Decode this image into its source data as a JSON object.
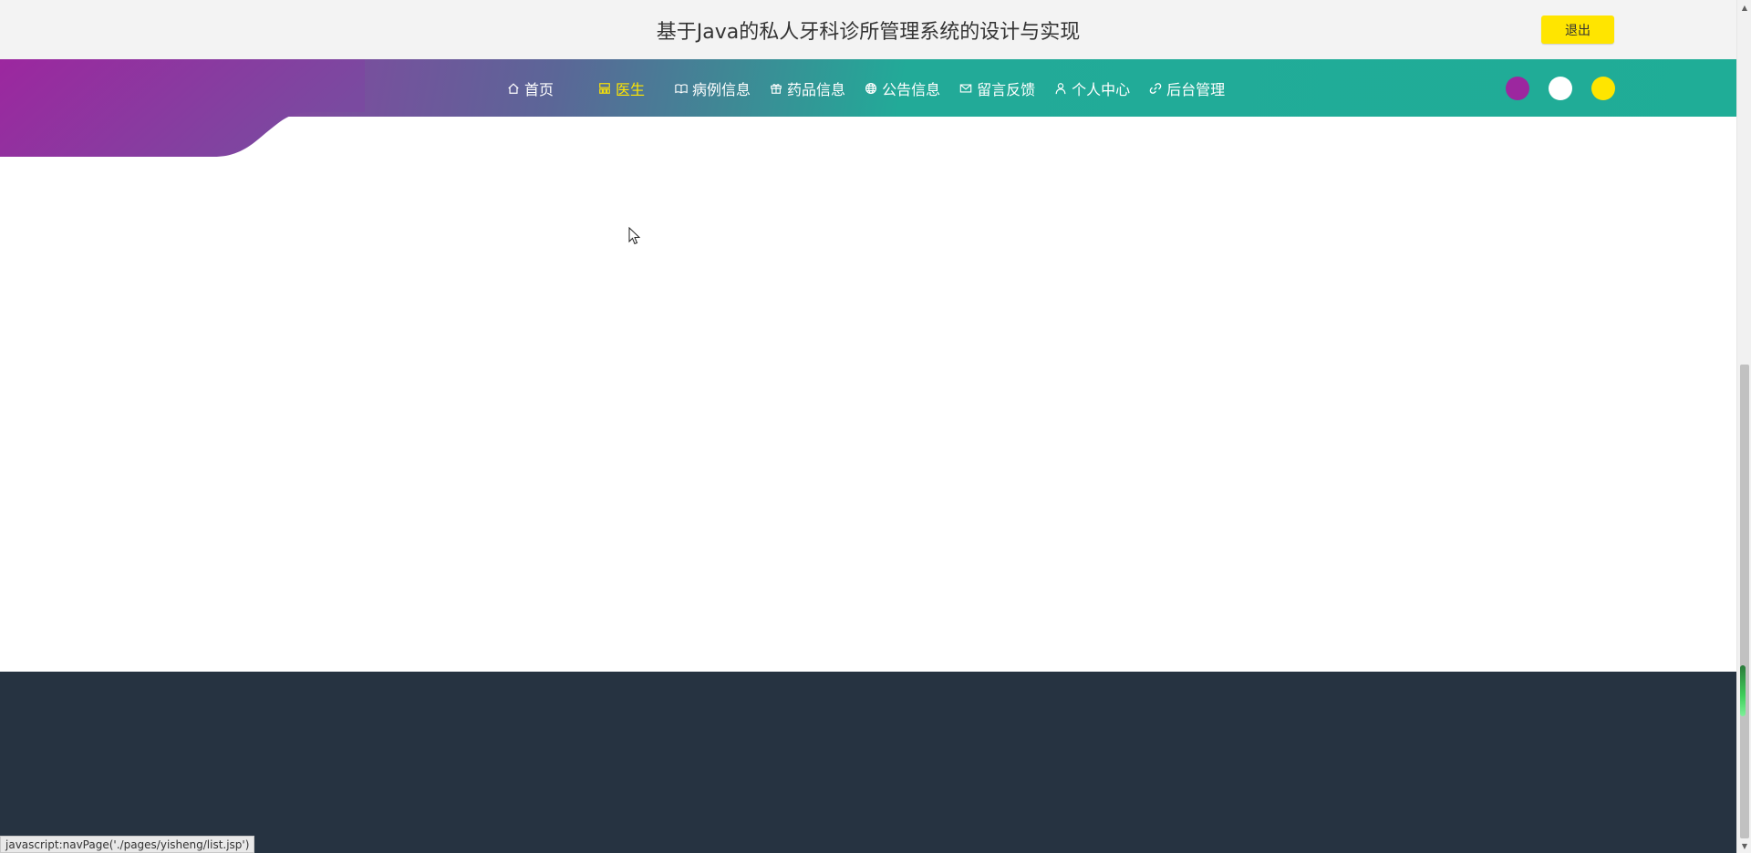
{
  "header": {
    "title": "基于Java的私人牙科诊所管理系统的设计与实现",
    "logout_label": "退出"
  },
  "nav": {
    "items": [
      {
        "label": "首页",
        "icon": "home-icon",
        "active": false
      },
      {
        "label": "医生",
        "icon": "doctor-icon",
        "active": true
      },
      {
        "label": "病例信息",
        "icon": "book-icon",
        "active": false
      },
      {
        "label": "药品信息",
        "icon": "gift-icon",
        "active": false
      },
      {
        "label": "公告信息",
        "icon": "globe-icon",
        "active": false
      },
      {
        "label": "留言反馈",
        "icon": "mail-icon",
        "active": false
      },
      {
        "label": "个人中心",
        "icon": "user-icon",
        "active": false
      },
      {
        "label": "后台管理",
        "icon": "link-icon",
        "active": false
      }
    ],
    "active_color": "#ffe500",
    "gradient_start": "#9c279f",
    "gradient_end": "#1fad97"
  },
  "theme_dots": [
    {
      "name": "purple",
      "color": "#9c279f"
    },
    {
      "name": "white",
      "color": "#ffffff"
    },
    {
      "name": "yellow",
      "color": "#ffe500"
    }
  ],
  "footer": {
    "color": "#263341"
  },
  "statusbar": {
    "text": "javascript:navPage('./pages/yisheng/list.jsp')"
  }
}
